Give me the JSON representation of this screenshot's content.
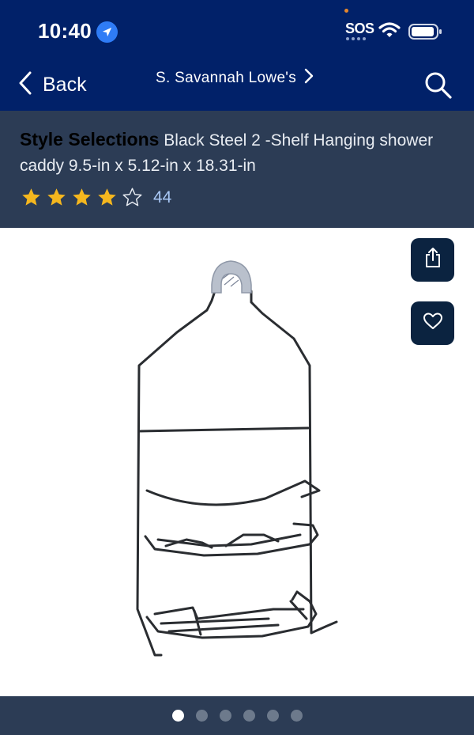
{
  "status_bar": {
    "time": "10:40",
    "sos": "SOS",
    "icons": [
      "location-arrow-icon",
      "wifi-icon",
      "battery-icon"
    ]
  },
  "nav": {
    "back_label": "Back",
    "store_name": "S. Savannah Lowe's",
    "icons": [
      "chevron-left-icon",
      "chevron-right-icon",
      "search-icon"
    ]
  },
  "product": {
    "brand": "Style Selections",
    "description": "Black Steel 2 -Shelf Hanging shower caddy 9.5-in x 5.12-in x 18.31-in",
    "rating": 4,
    "rating_max": 5,
    "review_count": "44"
  },
  "gallery": {
    "image_count": 6,
    "active_index": 0,
    "actions": [
      "share-icon",
      "heart-icon"
    ]
  },
  "colors": {
    "header_bg": "#012169",
    "title_band_bg": "#2c3c55",
    "star_fill": "#f5b71e",
    "action_button_bg": "#0b2340",
    "review_link": "#a9c8f5"
  }
}
